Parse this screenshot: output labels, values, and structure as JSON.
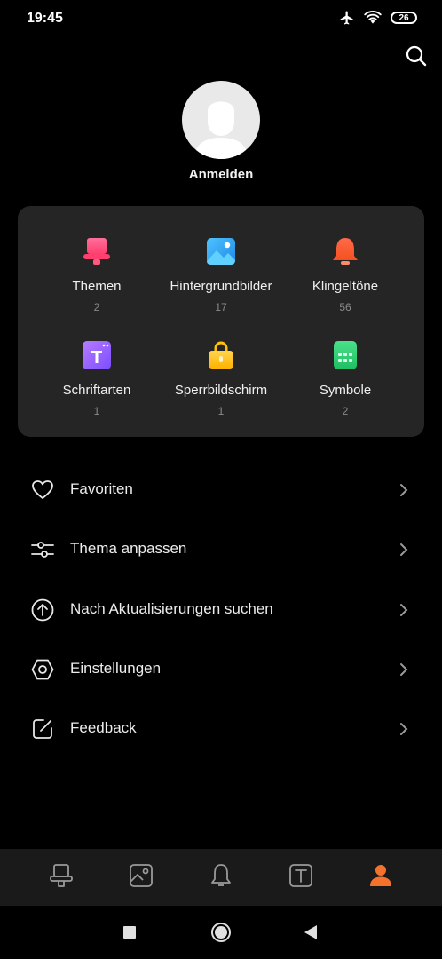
{
  "status_bar": {
    "time": "19:45",
    "battery": "26",
    "icons": [
      "airplane-icon",
      "wifi-icon",
      "battery-icon"
    ]
  },
  "header": {
    "search_icon": "search-icon"
  },
  "profile": {
    "signin_label": "Anmelden",
    "avatar_icon": "avatar-placeholder-icon"
  },
  "categories": [
    {
      "label": "Themen",
      "count": "2",
      "icon": "themes-icon"
    },
    {
      "label": "Hintergrundbilder",
      "count": "17",
      "icon": "wallpaper-icon"
    },
    {
      "label": "Klingeltöne",
      "count": "56",
      "icon": "ringtone-bell-icon"
    },
    {
      "label": "Schriftarten",
      "count": "1",
      "icon": "font-icon"
    },
    {
      "label": "Sperrbildschirm",
      "count": "1",
      "icon": "lockscreen-icon"
    },
    {
      "label": "Symbole",
      "count": "2",
      "icon": "symbols-icon"
    }
  ],
  "menu": [
    {
      "label": "Favoriten",
      "icon": "heart-icon"
    },
    {
      "label": "Thema anpassen",
      "icon": "sliders-icon"
    },
    {
      "label": "Nach Aktualisierungen suchen",
      "icon": "update-arrow-icon"
    },
    {
      "label": "Einstellungen",
      "icon": "settings-icon"
    },
    {
      "label": "Feedback",
      "icon": "feedback-icon"
    }
  ],
  "bottom_nav": [
    {
      "icon": "themes-tab-icon",
      "active": false
    },
    {
      "icon": "wallpaper-tab-icon",
      "active": false
    },
    {
      "icon": "ringtones-tab-icon",
      "active": false
    },
    {
      "icon": "fonts-tab-icon",
      "active": false
    },
    {
      "icon": "profile-tab-icon",
      "active": true
    }
  ],
  "system_nav": [
    "recents-icon",
    "home-icon",
    "back-icon"
  ],
  "colors": {
    "accent": "#f4722b",
    "card_bg": "#252525",
    "nav_bg": "#1a1a1a",
    "muted": "#8a8a8a"
  }
}
